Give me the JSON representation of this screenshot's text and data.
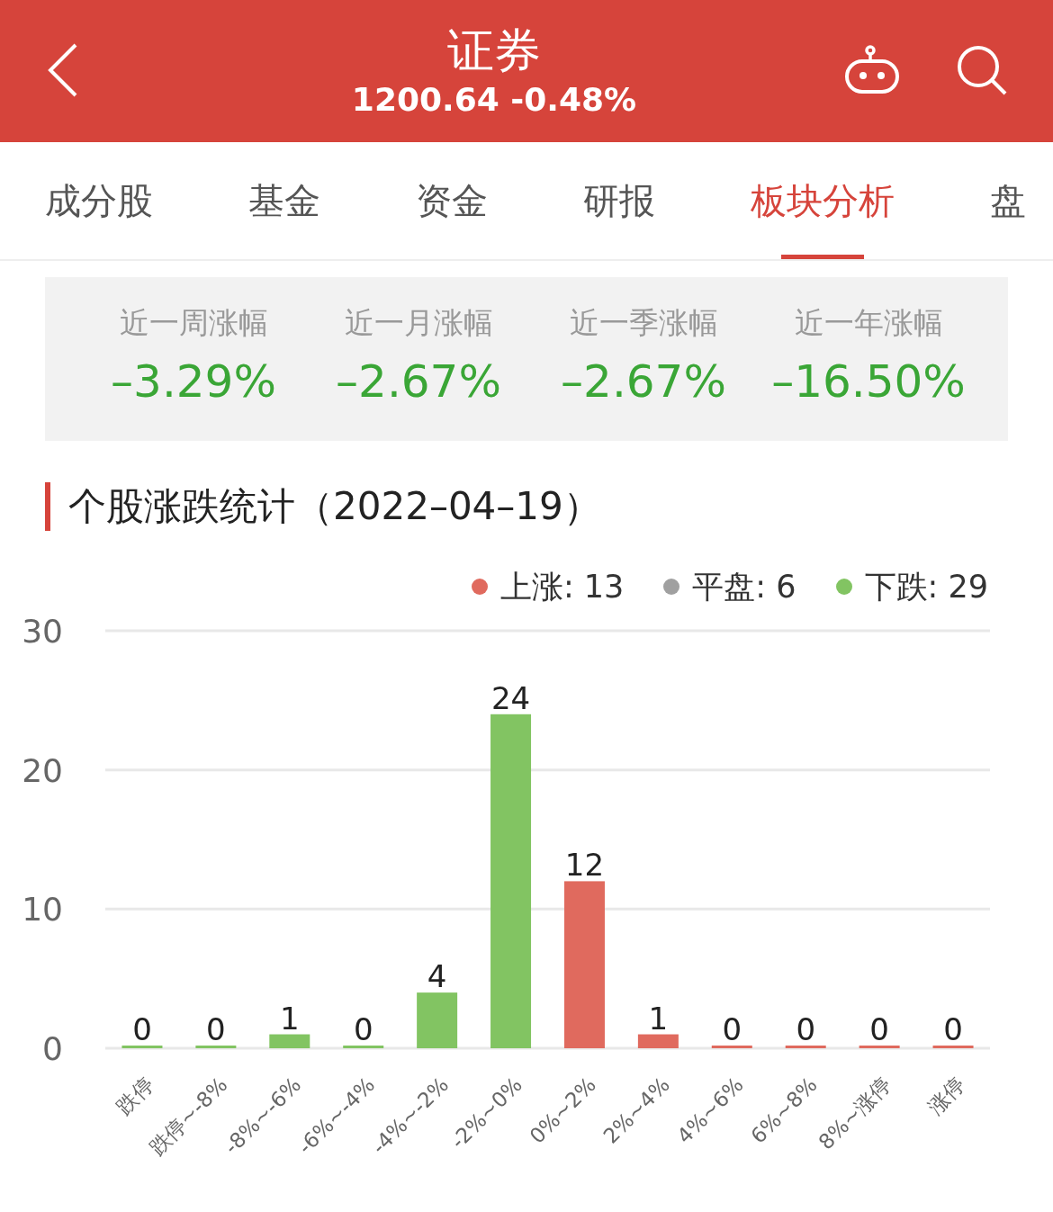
{
  "header": {
    "title": "证券",
    "quote": "1200.64 -0.48%"
  },
  "tabs": [
    {
      "label": "成分股",
      "selected": false
    },
    {
      "label": "基金",
      "selected": false
    },
    {
      "label": "资金",
      "selected": false
    },
    {
      "label": "研报",
      "selected": false
    },
    {
      "label": "板块分析",
      "selected": true
    },
    {
      "label": "盘",
      "selected": false
    }
  ],
  "stats": [
    {
      "label": "近一周涨幅",
      "value": "–3.29%"
    },
    {
      "label": "近一月涨幅",
      "value": "–2.67%"
    },
    {
      "label": "近一季涨幅",
      "value": "–2.67%"
    },
    {
      "label": "近一年涨幅",
      "value": "–16.50%"
    }
  ],
  "section": {
    "title": "个股涨跌统计（2022–04–19）"
  },
  "legend": [
    {
      "label": "上涨: 13",
      "color": "#e06a5e"
    },
    {
      "label": "平盘: 6",
      "color": "#a0a0a0"
    },
    {
      "label": "下跌: 29",
      "color": "#82c462"
    }
  ],
  "chart_data": {
    "type": "bar",
    "stacked": true,
    "data_labels": true,
    "ylim": [
      0,
      30
    ],
    "yticks": [
      0,
      10,
      20,
      30
    ],
    "categories": [
      "跌停",
      "跌停~-8%",
      "-8%~-6%",
      "-6%~-4%",
      "-4%~-2%",
      "-2%~0%",
      "0%~2%",
      "2%~4%",
      "4%~6%",
      "6%~8%",
      "8%~涨停",
      "涨停"
    ],
    "series": [
      {
        "color": "#82c462",
        "values": [
          0,
          0,
          1,
          0,
          4,
          24,
          null,
          null,
          null,
          null,
          null,
          null
        ]
      },
      {
        "color": "#e06a5e",
        "values": [
          null,
          null,
          null,
          null,
          null,
          null,
          12,
          1,
          0,
          0,
          0,
          0
        ]
      }
    ]
  }
}
